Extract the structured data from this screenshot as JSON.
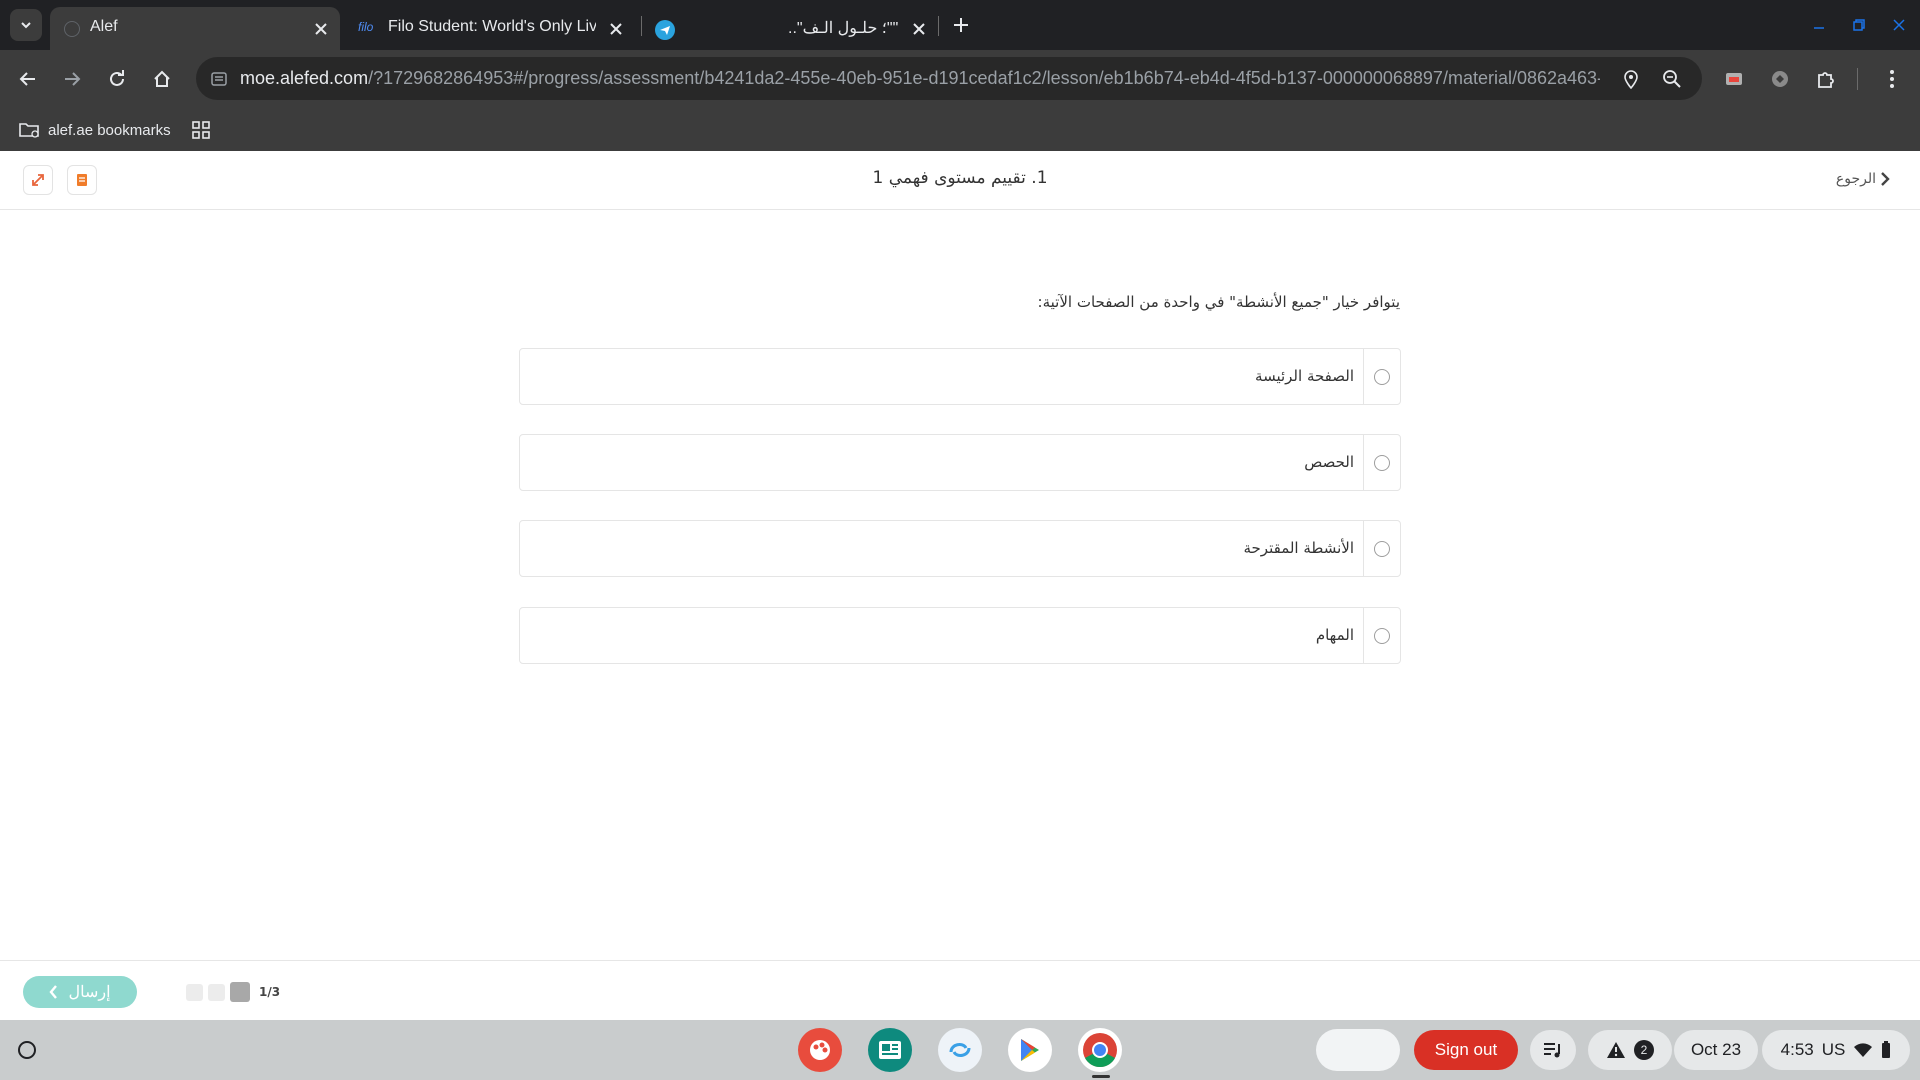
{
  "browser": {
    "tabs": [
      {
        "title": "Alef",
        "active": true
      },
      {
        "title": "Filo Student: World's Only Live I",
        "favicon_text": "filo"
      },
      {
        "title": "\"\"؛ حلـول الـف\"..",
        "favicon": "telegram-icon"
      }
    ],
    "url_host": "moe.alefed.com",
    "url_path": "/?1729682864953#/progress/assessment/b4241da2-455e-40eb-951e-d191cedaf1c2/lesson/eb1b6b74-eb4d-4f5d-b137-000000068897/material/0862a463-...",
    "bookmarks": [
      {
        "label": "alef.ae bookmarks"
      }
    ]
  },
  "page": {
    "title": "1. تقييم مستوى فهمي 1",
    "back_label": "الرجوع",
    "question": "يتوافر خيار \"جميع الأنشطة\" في واحدة من الصفحات الآتية:",
    "options": [
      {
        "label": "الصفحة الرئيسة",
        "selected": false
      },
      {
        "label": "الحصص",
        "selected": false
      },
      {
        "label": "الأنشطة المقترحة",
        "selected": false
      },
      {
        "label": "المهام",
        "selected": false
      }
    ],
    "submit_label": "إرسال",
    "progress": {
      "label": "1/3",
      "current": 1,
      "total": 3
    }
  },
  "shelf": {
    "sign_out_label": "Sign out",
    "notification_count": "2",
    "date": "Oct 23",
    "time": "4:53",
    "locale": "US"
  },
  "colors": {
    "submit_bg": "#8fd9cf",
    "sign_out_bg": "#d93025",
    "tabstrip_bg": "#202124",
    "toolbar_bg": "#3c3c3c"
  }
}
